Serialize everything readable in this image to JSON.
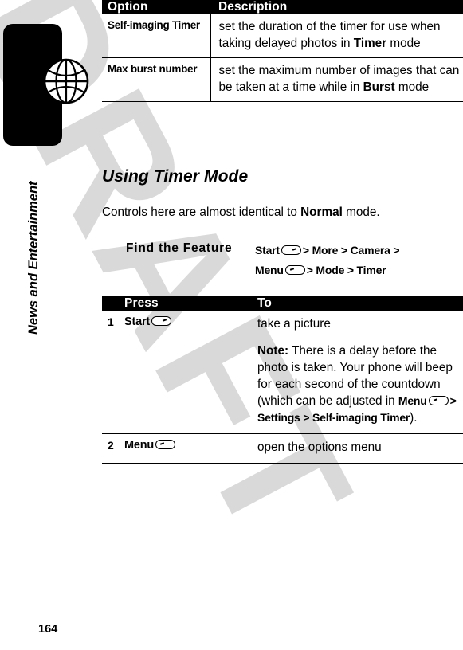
{
  "document": {
    "page_number": "164",
    "chapter_label": "News and Entertainment",
    "watermark": "DRAFT",
    "tab_icon": "globe-icon"
  },
  "options_table": {
    "headers": {
      "option": "Option",
      "description": "Description"
    },
    "rows": [
      {
        "option": "Self-imaging Timer",
        "description_pre": "set the duration of the timer for use when taking delayed photos in ",
        "description_bold": "Timer",
        "description_post": " mode"
      },
      {
        "option": "Max burst number",
        "description_pre": "set the maximum number of images that can be taken at a time while in ",
        "description_bold": "Burst",
        "description_post": " mode"
      }
    ]
  },
  "section": {
    "heading": "Using Timer Mode",
    "intro_pre": "Controls here are almost identical to ",
    "intro_bold": "Normal",
    "intro_post": " mode."
  },
  "find_feature": {
    "label": "Find the Feature",
    "line1_key": "Start",
    "line1_key_icon": "softkey-right-icon",
    "line1_rest": "> More > Camera >",
    "line2_key": "Menu",
    "line2_key_icon": "softkey-left-icon",
    "line2_rest": "> Mode > Timer"
  },
  "press_table": {
    "headers": {
      "number": "",
      "press": "Press",
      "to": "To"
    },
    "rows": [
      {
        "number": "1",
        "press_key": "Start",
        "press_key_icon": "softkey-right-icon",
        "to_line1": "take a picture",
        "note_label": "Note:",
        "note_text_1": " There is a delay before the photo is taken. Your phone will beep for each second of the countdown (which can be adjusted in ",
        "note_key": "Menu",
        "note_key_icon": "softkey-left-icon",
        "note_path": "> Settings > Self-imaging Timer",
        "note_close": ")."
      },
      {
        "number": "2",
        "press_key": "Menu",
        "press_key_icon": "softkey-left-icon",
        "to_line1": "open the options menu"
      }
    ]
  },
  "colors": {
    "header_bg": "#000000",
    "header_text": "#ffffff",
    "body_text": "#000000",
    "watermark": "#d9d9d9",
    "page_bg": "#ffffff"
  }
}
